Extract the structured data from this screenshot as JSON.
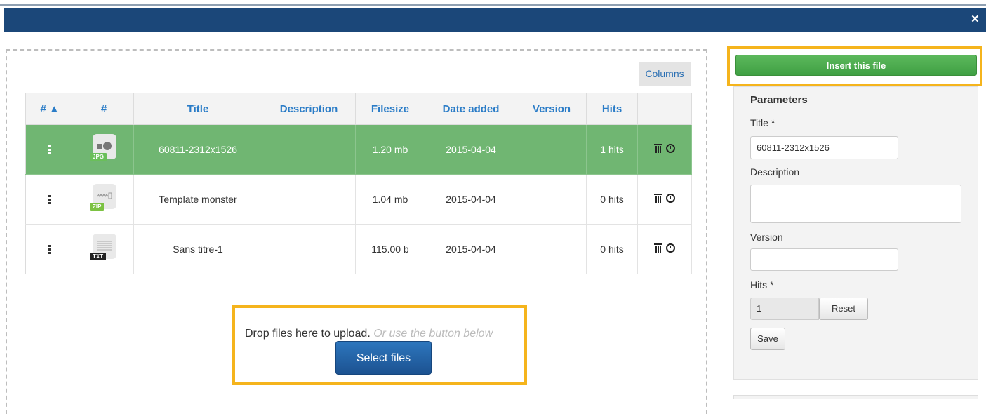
{
  "modal": {
    "close_label": "×"
  },
  "toolbar": {
    "columns_label": "Columns"
  },
  "table": {
    "headers": [
      "# ▲",
      "#",
      "Title",
      "Description",
      "Filesize",
      "Date added",
      "Version",
      "Hits",
      ""
    ],
    "rows": [
      {
        "icon": "jpg-file-icon",
        "tag": "JPG",
        "tag_color": "#6abf5a",
        "title": "60811-2312x1526",
        "description": "",
        "filesize": "1.20 mb",
        "date": "2015-04-04",
        "version": "",
        "hits": "1 hits",
        "selected": true
      },
      {
        "icon": "zip-file-icon",
        "tag": "ZIP",
        "tag_color": "#7cc242",
        "title": "Template monster",
        "description": "",
        "filesize": "1.04 mb",
        "date": "2015-04-04",
        "version": "",
        "hits": "0 hits",
        "selected": false
      },
      {
        "icon": "txt-file-icon",
        "tag": "TXT",
        "tag_color": "#222222",
        "title": "Sans titre-1",
        "description": "",
        "filesize": "115.00 b",
        "date": "2015-04-04",
        "version": "",
        "hits": "0 hits",
        "selected": false
      }
    ]
  },
  "upload": {
    "drop_text": "Drop files here to upload.",
    "drop_hint": "Or use the button below",
    "select_label": "Select files"
  },
  "sidebar": {
    "insert_label": "Insert this file",
    "params_heading": "Parameters",
    "title_label": "Title *",
    "title_value": "60811-2312x1526",
    "description_label": "Description",
    "description_value": "",
    "version_label": "Version",
    "version_value": "",
    "hits_label": "Hits *",
    "hits_value": "1",
    "reset_label": "Reset",
    "save_label": "Save"
  },
  "colors": {
    "header_bar": "#1b4779",
    "selected_row": "#70b672",
    "highlight": "#f5b41c",
    "primary": "#1c5291",
    "success": "#5cb85c"
  }
}
